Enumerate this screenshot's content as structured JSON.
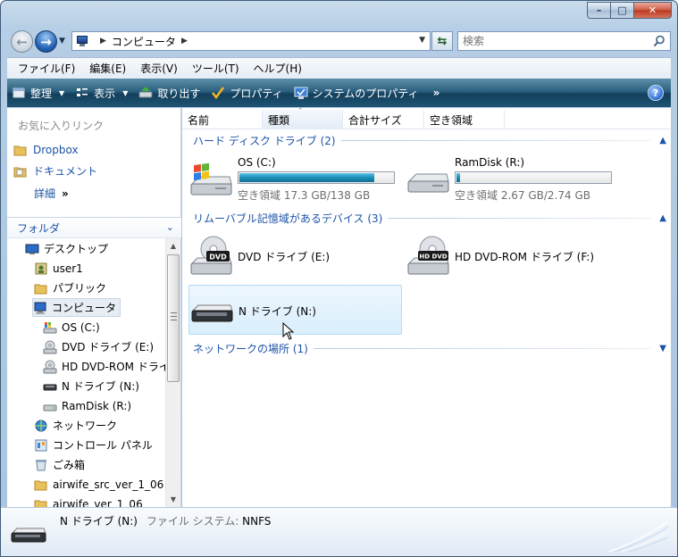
{
  "window": {
    "caption_minimize": "–",
    "caption_maximize": "□",
    "caption_close": "✕"
  },
  "address": {
    "location": "コンピュータ",
    "search_placeholder": "検索"
  },
  "menu": [
    "ファイル(F)",
    "編集(E)",
    "表示(V)",
    "ツール(T)",
    "ヘルプ(H)"
  ],
  "commands": {
    "organize": "整理",
    "view": "表示",
    "eject": "取り出す",
    "properties": "プロパティ",
    "system_properties": "システムのプロパティ",
    "more": "»",
    "help": "?"
  },
  "navpane": {
    "favorites_header": "お気に入りリンク",
    "favorites": [
      "Dropbox",
      "ドキュメント"
    ],
    "more": "詳細",
    "more_chevron": "»",
    "folders_header": "フォルダ",
    "tree": [
      {
        "label": "デスクトップ",
        "icon": "desktop-icon"
      },
      {
        "label": "user1",
        "icon": "user-folder-icon"
      },
      {
        "label": "パブリック",
        "icon": "folder-icon"
      },
      {
        "label": "コンピュータ",
        "icon": "computer-icon",
        "selected": true
      },
      {
        "label": "OS (C:)",
        "icon": "windows-drive-icon"
      },
      {
        "label": "DVD ドライブ (E:)",
        "icon": "dvd-drive-icon"
      },
      {
        "label": "HD DVD-ROM ドライ",
        "icon": "hd-dvd-drive-icon"
      },
      {
        "label": "N ドライブ (N:)",
        "icon": "removable-drive-icon"
      },
      {
        "label": "RamDisk (R:)",
        "icon": "hard-drive-icon"
      },
      {
        "label": "ネットワーク",
        "icon": "network-icon"
      },
      {
        "label": "コントロール パネル",
        "icon": "control-panel-icon"
      },
      {
        "label": "ごみ箱",
        "icon": "recycle-bin-icon"
      },
      {
        "label": "airwife_src_ver_1_06",
        "icon": "folder-icon"
      },
      {
        "label": "airwife_ver_1_06",
        "icon": "folder-icon"
      }
    ]
  },
  "columns": [
    "名前",
    "種類",
    "合計サイズ",
    "空き領域"
  ],
  "groups": {
    "hard_disks": "ハード ディスク ドライブ (2)",
    "removable": "リムーバブル記憶域があるデバイス (3)",
    "network": "ネットワークの場所 (1)"
  },
  "drives": {
    "os": {
      "name": "OS (C:)",
      "free": "空き領域 17.3 GB/138 GB",
      "used_fraction": 0.875
    },
    "ramdisk": {
      "name": "RamDisk (R:)",
      "free": "空き領域 2.67 GB/2.74 GB",
      "used_fraction": 0.026
    },
    "dvd": {
      "name": "DVD ドライブ (E:)",
      "badge": "DVD"
    },
    "hddvd": {
      "name": "HD DVD-ROM ドライブ (F:)",
      "badge": "HD DVD"
    },
    "ndrive": {
      "name": "N ドライブ (N:)"
    }
  },
  "details": {
    "name": "N ドライブ (N:)",
    "fs_label": "ファイル システム:",
    "fs_value": "NNFS"
  },
  "colors": {
    "accent": "#1c53a6",
    "command_bar": "#2b5f7e",
    "drive_bar": "#1b8fb9"
  }
}
